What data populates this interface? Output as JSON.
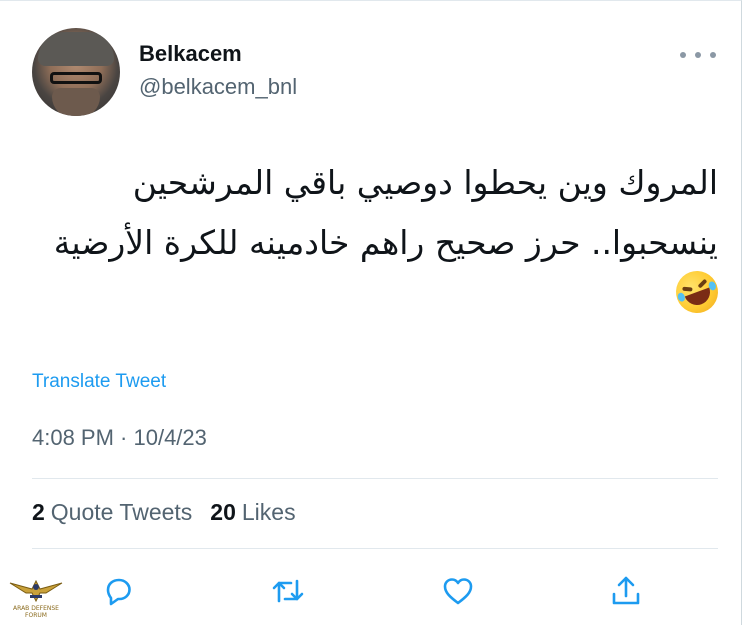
{
  "tweet": {
    "author_name": "Belkacem",
    "author_handle": "@belkacem_bnl",
    "text": "المروك وين يحطوا دوصيي باقي المرشحين ينسحبوا.. حرز صحيح راهم خادمينه للكرة الأرضية",
    "emoji": "rolling-on-the-floor-laughing",
    "translate_label": "Translate Tweet",
    "timestamp": "4:08 PM · 10/4/23"
  },
  "stats": {
    "quote_tweets_count": "2",
    "quote_tweets_label": "Quote Tweets",
    "likes_count": "20",
    "likes_label": "Likes"
  },
  "actions": [
    {
      "icon": "reply-icon"
    },
    {
      "icon": "retweet-icon"
    },
    {
      "icon": "like-icon"
    },
    {
      "icon": "share-icon"
    }
  ],
  "colors": {
    "accent": "#1d9bf0",
    "secondary_text": "#536471",
    "icon": "#1d9bf0"
  },
  "watermark": {
    "text": "ARAB DEFENSE FORUM"
  }
}
